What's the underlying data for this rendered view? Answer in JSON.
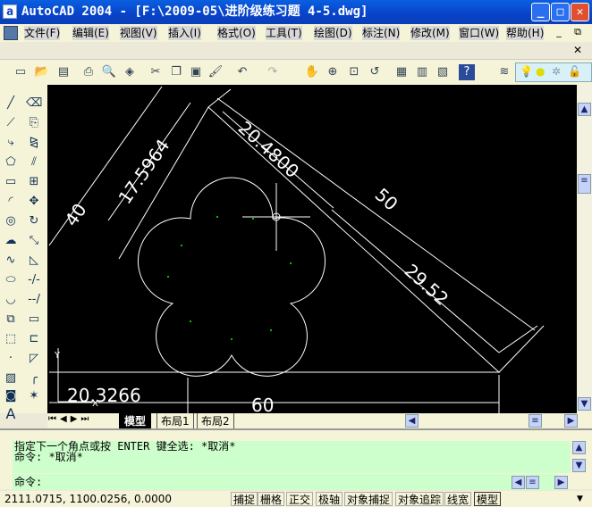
{
  "window": {
    "title": "AutoCAD 2004 - [F:\\2009-05\\进阶级练习题 4-5.dwg]",
    "minimize": "_",
    "maximize": "□",
    "close": "✕"
  },
  "menu": [
    "文件(F)",
    "编辑(E)",
    "视图(V)",
    "插入(I)",
    "格式(O)",
    "工具(T)",
    "绘图(D)",
    "标注(N)",
    "修改(M)",
    "窗口(W)",
    "帮助(H)"
  ],
  "drawing": {
    "dims": [
      "40",
      "17.5964",
      "20.4800",
      "50",
      "29.52",
      "20.3266",
      "60"
    ],
    "axis_y": "Y",
    "axis_x": "X"
  },
  "tabs": [
    "模型",
    "布局1",
    "布局2"
  ],
  "command": {
    "history": [
      "指定下一个角点或按 ENTER 键全选: *取消*",
      "命令: *取消*"
    ],
    "prompt": "命令:"
  },
  "status": {
    "coords": "2111.0715, 1100.0256, 0.0000",
    "buttons": [
      "捕捉",
      "栅格",
      "正交",
      "极轴",
      "对象捕捉",
      "对象追踪",
      "线宽",
      "模型"
    ]
  }
}
